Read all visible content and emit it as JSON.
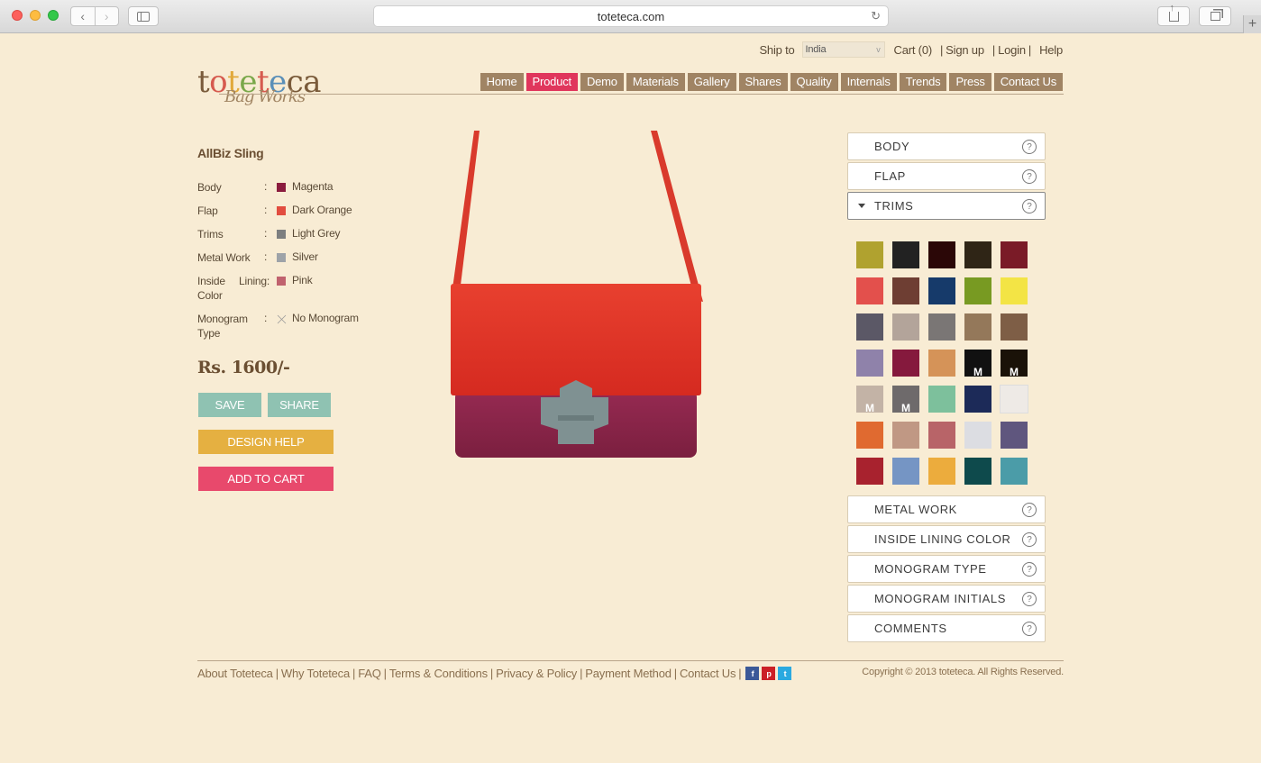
{
  "browser": {
    "url": "toteteca.com",
    "back_glyph": "‹",
    "forward_glyph": "›",
    "new_tab_glyph": "+"
  },
  "topbar": {
    "ship_to_label": "Ship to",
    "country_value": "India",
    "cart_label": "Cart (0)",
    "signup_label": "Sign up",
    "login_label": "Login",
    "help_label": "Help",
    "separator": "|"
  },
  "logo": {
    "letters": [
      "t",
      "o",
      "t",
      "e",
      "t",
      "e",
      "c",
      "a"
    ],
    "subtitle": "Bag Works"
  },
  "nav": {
    "items": [
      {
        "label": "Home",
        "active": false
      },
      {
        "label": "Product",
        "active": true
      },
      {
        "label": "Demo",
        "active": false
      },
      {
        "label": "Materials",
        "active": false
      },
      {
        "label": "Gallery",
        "active": false
      },
      {
        "label": "Shares",
        "active": false
      },
      {
        "label": "Quality",
        "active": false
      },
      {
        "label": "Internals",
        "active": false
      },
      {
        "label": "Trends",
        "active": false
      },
      {
        "label": "Press",
        "active": false
      },
      {
        "label": "Contact Us",
        "active": false
      }
    ]
  },
  "product": {
    "title": "AllBiz Sling",
    "colon": ":",
    "specs": [
      {
        "label": "Body",
        "value": "Magenta",
        "swatch": "#8b1c3e"
      },
      {
        "label": "Flap",
        "value": "Dark Orange",
        "swatch": "#e24d3f"
      },
      {
        "label": "Trims",
        "value": "Light Grey",
        "swatch": "#7d7f80"
      },
      {
        "label": "Metal Work",
        "value": "Silver",
        "swatch": "#9ea3a8"
      },
      {
        "label": "Inside Lining: Color",
        "value": "Pink",
        "swatch": "#c0626e"
      },
      {
        "label": "Monogram Type",
        "value": "No Monogram",
        "swatch": "none"
      }
    ],
    "price": "Rs. 1600/-",
    "save_label": "SAVE",
    "share_label": "SHARE",
    "design_help_label": "DESIGN HELP",
    "add_to_cart_label": "ADD TO CART",
    "bag_colors": {
      "strap": "#d93a2c",
      "flap": "#db2e22",
      "body": "#8a2347",
      "clasp": "#7f9192"
    }
  },
  "customizer": {
    "help_glyph": "?",
    "sections_top": [
      "BODY",
      "FLAP"
    ],
    "open_section": "TRIMS",
    "sections_bottom": [
      "METAL WORK",
      "INSIDE LINING COLOR",
      "MONOGRAM TYPE",
      "MONOGRAM INITIALS",
      "COMMENTS"
    ],
    "monogram_badge": "M",
    "swatches": [
      [
        "#b0a22f",
        "#222222",
        "#2b0707",
        "#2f2516",
        "#7a1b27"
      ],
      [
        "#e3504c",
        "#6e3e33",
        "#163a6a",
        "#789a22",
        "#f3e445"
      ],
      [
        "#5b5866",
        "#b3a49a",
        "#7a7675",
        "#94785a",
        "#7e5e46"
      ],
      [
        "#8f82aa",
        "#85193d",
        "#d59358",
        "#111111",
        "#1a1208"
      ],
      [
        "#c3b3a6",
        "#6e6a6b",
        "#7dc09c",
        "#1c2a58",
        "#eeeae6"
      ],
      [
        "#e06a30",
        "#c09884",
        "#b86468",
        "#dcdde2",
        "#5f567e"
      ],
      [
        "#a8222e",
        "#7595c4",
        "#ecac3d",
        "#0e4a4c",
        "#4b9ca8"
      ]
    ],
    "monogram_swatches": [
      "3-3",
      "3-4",
      "4-0",
      "4-1"
    ]
  },
  "footer": {
    "links": [
      "About Toteteca",
      "Why Toteteca",
      "FAQ",
      "Terms & Conditions",
      "Privacy & Policy",
      "Payment Method",
      "Contact Us"
    ],
    "social": [
      {
        "name": "facebook-icon",
        "glyph": "f"
      },
      {
        "name": "pinterest-icon",
        "glyph": "p"
      },
      {
        "name": "twitter-icon",
        "glyph": "t"
      }
    ],
    "copyright": "Copyright © 2013 toteteca. All Rights Reserved."
  }
}
